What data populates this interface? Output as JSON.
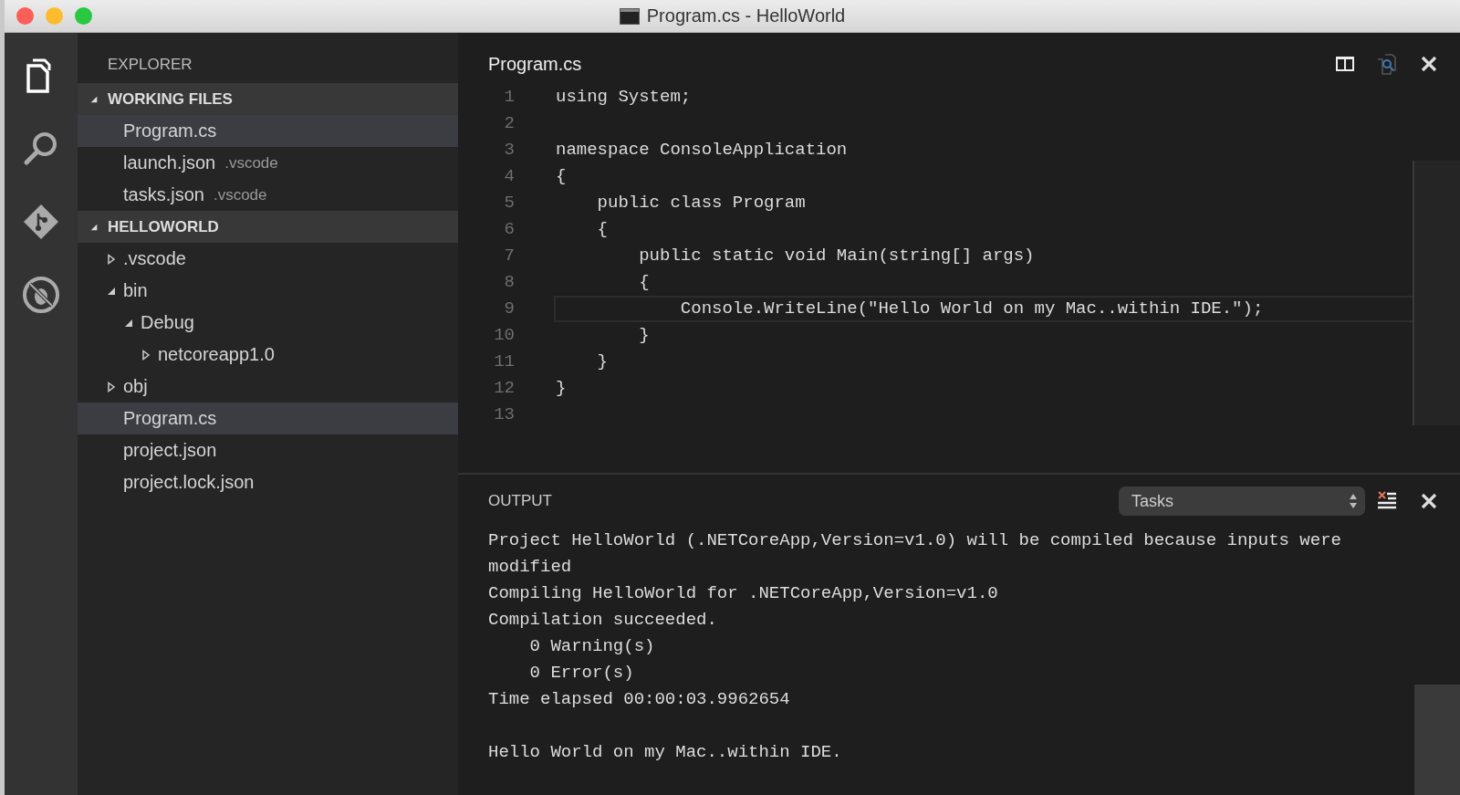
{
  "window": {
    "title": "Program.cs - HelloWorld"
  },
  "sidebar": {
    "title": "EXPLORER",
    "sections": [
      {
        "title": "WORKING FILES",
        "expanded": true,
        "items": [
          {
            "label": "Program.cs",
            "kind": "file",
            "selected": true
          },
          {
            "label": "launch.json",
            "hint": ".vscode",
            "kind": "file",
            "selected": false
          },
          {
            "label": "tasks.json",
            "hint": ".vscode",
            "kind": "file",
            "selected": false
          }
        ]
      },
      {
        "title": "HELLOWORLD",
        "expanded": true,
        "items": [
          {
            "label": ".vscode",
            "kind": "folder",
            "expanded": false,
            "selected": false
          },
          {
            "label": "bin",
            "kind": "folder",
            "expanded": true,
            "selected": false,
            "children": [
              {
                "label": "Debug",
                "kind": "folder",
                "expanded": true,
                "selected": false,
                "children": [
                  {
                    "label": "netcoreapp1.0",
                    "kind": "folder",
                    "expanded": false,
                    "selected": false
                  }
                ]
              }
            ]
          },
          {
            "label": "obj",
            "kind": "folder",
            "expanded": false,
            "selected": false
          },
          {
            "label": "Program.cs",
            "kind": "file",
            "selected": true
          },
          {
            "label": "project.json",
            "kind": "file",
            "selected": false
          },
          {
            "label": "project.lock.json",
            "kind": "file",
            "selected": false
          }
        ]
      }
    ]
  },
  "editor": {
    "title": "Program.cs",
    "lines": [
      {
        "number": "1",
        "text": "using System;",
        "current": false
      },
      {
        "number": "2",
        "current": false
      },
      {
        "number": "3",
        "text": "namespace ConsoleApplication",
        "current": false
      },
      {
        "number": "4",
        "text": "{",
        "current": false
      },
      {
        "number": "5",
        "text": "    public class Program",
        "current": false
      },
      {
        "number": "6",
        "text": "    {",
        "current": false
      },
      {
        "number": "7",
        "text": "        public static void Main(string[] args)",
        "current": false
      },
      {
        "number": "8",
        "text": "        {",
        "current": false
      },
      {
        "number": "9",
        "text": "            Console.WriteLine(\"Hello World on my Mac..within IDE.\");",
        "current": true
      },
      {
        "number": "10",
        "text": "        }",
        "current": false
      },
      {
        "number": "11",
        "text": "    }",
        "current": false
      },
      {
        "number": "12",
        "text": "}",
        "current": false
      },
      {
        "number": "13",
        "current": false
      }
    ]
  },
  "output": {
    "title": "OUTPUT",
    "channel": "Tasks",
    "blocks": [
      {
        "lines": [
          "Project HelloWorld (.NETCoreApp,Version=v1.0) will be compiled because inputs were modified",
          "Compiling HelloWorld for .NETCoreApp,Version=v1.0",
          "Compilation succeeded.",
          "    0 Warning(s)",
          "    0 Error(s)",
          "Time elapsed 00:00:03.9962654"
        ]
      },
      {
        "lines": [
          "Hello World on my Mac..within IDE."
        ]
      }
    ]
  }
}
